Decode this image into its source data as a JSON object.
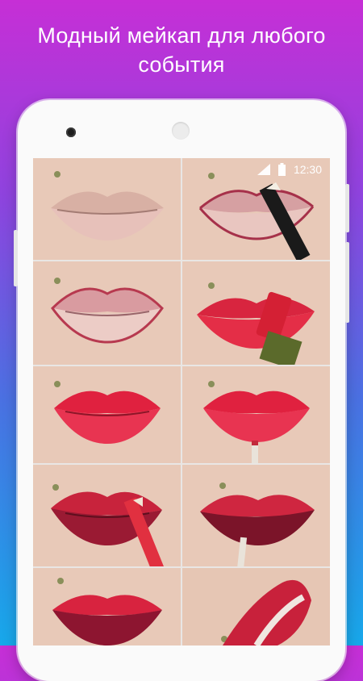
{
  "headline": {
    "line1": "Модный мейкап для любого",
    "line2": "события"
  },
  "status_bar": {
    "time": "12:30",
    "icons": [
      "signal-icon",
      "battery-icon"
    ]
  },
  "colors": {
    "gradient_top": "#c62fd6",
    "gradient_bottom": "#17a8ea",
    "phone_body": "#fafafa",
    "skin": "#e9ccb9",
    "lip_red": "#e2213c",
    "lip_dark": "#7d1328"
  },
  "gallery": [
    {
      "step": "natural-lips"
    },
    {
      "step": "lip-liner-pencil"
    },
    {
      "step": "outlined-lips"
    },
    {
      "step": "red-lipstick-application"
    },
    {
      "step": "red-lips"
    },
    {
      "step": "lip-brush"
    },
    {
      "step": "dark-ombre-pencil"
    },
    {
      "step": "ombre-brush"
    },
    {
      "step": "finished-ombre-lips"
    },
    {
      "step": "side-profile-lips"
    }
  ]
}
